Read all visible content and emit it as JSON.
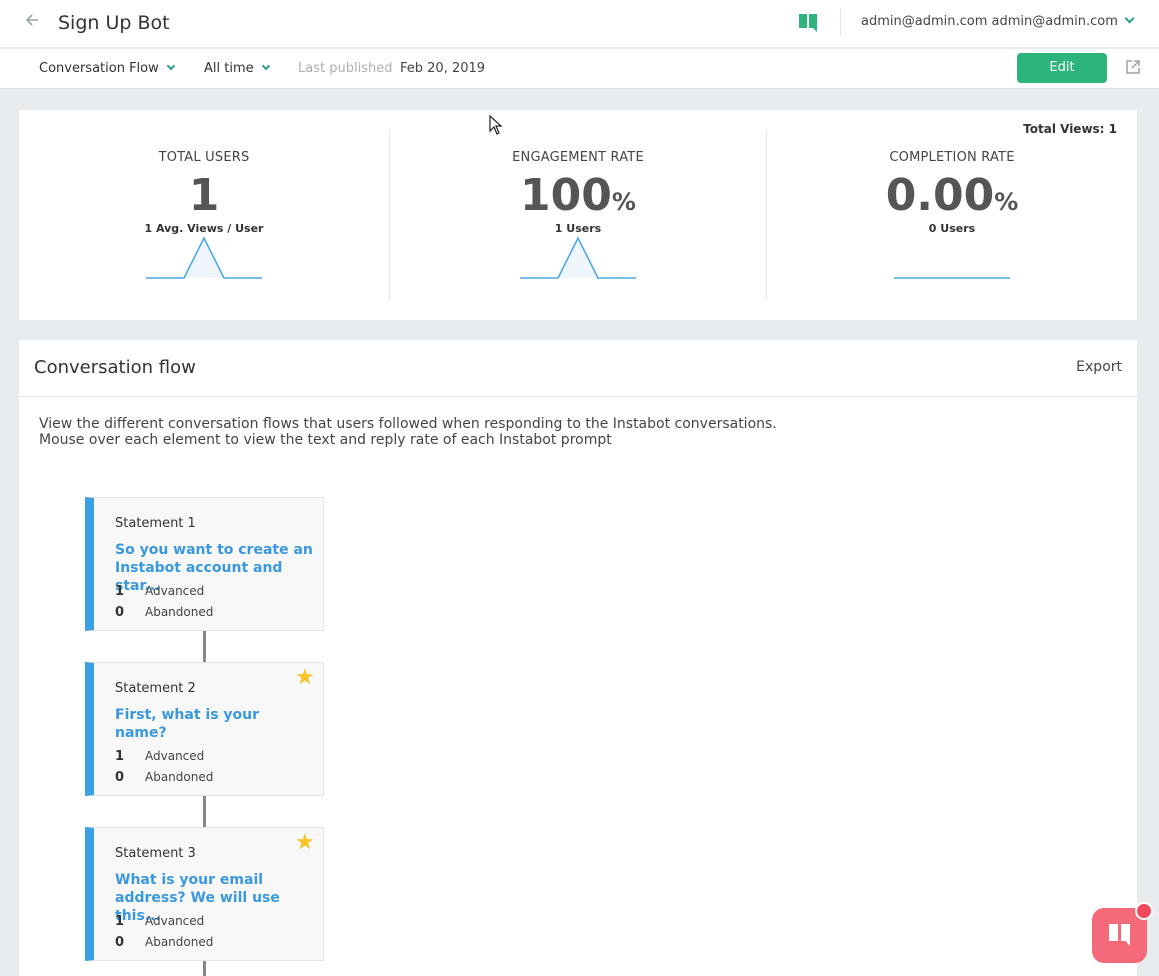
{
  "header": {
    "title": "Sign Up Bot",
    "user_label": "admin@admin.com admin@admin.com"
  },
  "toolbar": {
    "view_select": "Conversation Flow",
    "time_select": "All time",
    "last_published_label": "Last published",
    "last_published_date": "Feb 20, 2019",
    "edit_label": "Edit"
  },
  "stats": {
    "total_views": "Total Views: 1",
    "total_users": {
      "label": "TOTAL USERS",
      "value": "1",
      "unit": "",
      "sub": "1 Avg. Views / User"
    },
    "engagement": {
      "label": "ENGAGEMENT RATE",
      "value": "100",
      "unit": "%",
      "sub": "1 Users"
    },
    "completion": {
      "label": "COMPLETION RATE",
      "value": "0.00",
      "unit": "%",
      "sub": "0 Users"
    }
  },
  "flow": {
    "title": "Conversation flow",
    "export_label": "Export",
    "desc_line1": "View the different conversation flows that users followed when responding to the Instabot conversations.",
    "desc_line2": "Mouse over each element to view the text and reply rate of each Instabot prompt",
    "statements": [
      {
        "name": "Statement 1",
        "question": "So you want to create an Instabot account and star...",
        "advanced": "1",
        "advanced_label": "Advanced",
        "abandoned": "0",
        "abandoned_label": "Abandoned",
        "starred": false
      },
      {
        "name": "Statement 2",
        "question": "First, what is your name?",
        "advanced": "1",
        "advanced_label": "Advanced",
        "abandoned": "0",
        "abandoned_label": "Abandoned",
        "starred": true
      },
      {
        "name": "Statement 3",
        "question": "What is your email address? We will use this...",
        "advanced": "1",
        "advanced_label": "Advanced",
        "abandoned": "0",
        "abandoned_label": "Abandoned",
        "starred": true
      }
    ]
  },
  "colors": {
    "accent_green": "#2cb47c",
    "link_blue": "#3a98df",
    "card_border_blue": "#3aa0e4",
    "star_yellow": "#f7c325",
    "chat_pink": "#f46a7a"
  }
}
